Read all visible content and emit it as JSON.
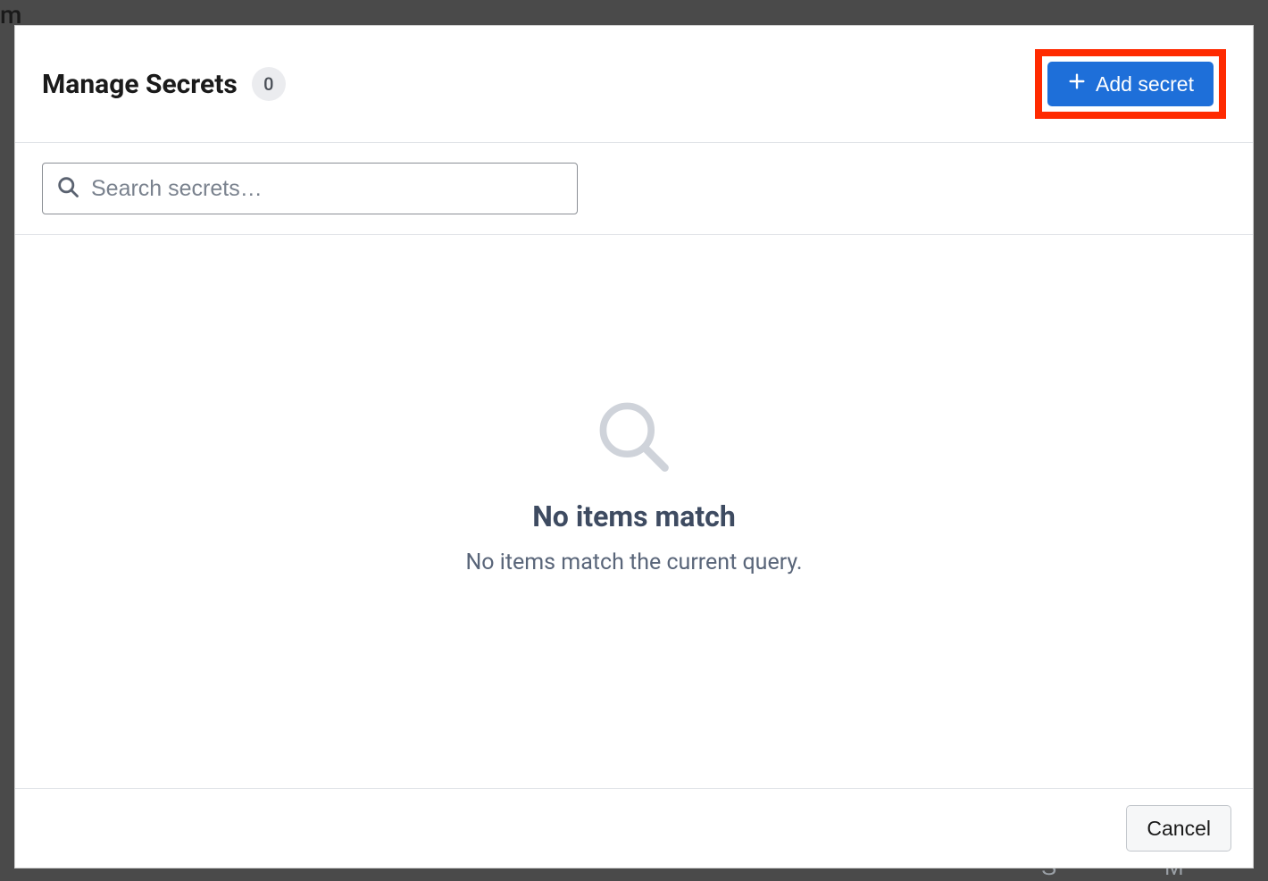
{
  "header": {
    "title": "Manage Secrets",
    "count": "0",
    "add_button_label": "Add secret"
  },
  "search": {
    "placeholder": "Search secrets…",
    "value": ""
  },
  "empty_state": {
    "title": "No items match",
    "subtitle": "No items match the current query."
  },
  "footer": {
    "cancel_label": "Cancel"
  },
  "colors": {
    "primary": "#1e6fd9",
    "highlight": "#ff2a00"
  },
  "highlighted_element": "add-secret-button"
}
